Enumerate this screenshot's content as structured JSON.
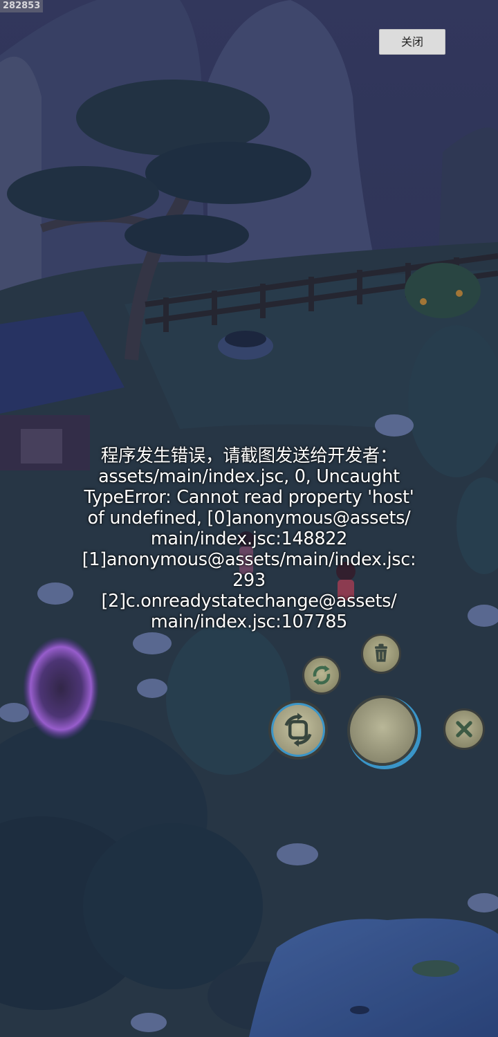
{
  "build_id": "282853",
  "close_button": {
    "label": "关闭"
  },
  "error": {
    "lines": [
      "程序发生错误，请截图发送给开发者：",
      "assets/main/index.jsc, 0, Uncaught",
      "TypeError: Cannot read property 'host'",
      "of undefined, [0]anonymous@assets/",
      "main/index.jsc:148822",
      "[1]anonymous@assets/main/index.jsc:",
      "293",
      "[2]c.onreadystatechange@assets/",
      "main/index.jsc:107785"
    ]
  },
  "controls": {
    "refresh_icon": "refresh-icon",
    "trash_icon": "trash-icon",
    "rotate_icon": "rotate-icon",
    "joystick": "joystick",
    "close_icon": "close-icon"
  },
  "colors": {
    "sky": "#2b3058",
    "foliage": "#2e4a55",
    "water": "#3a5a9a",
    "portal": "#a45be0",
    "control_ring": "#3a95c8"
  }
}
